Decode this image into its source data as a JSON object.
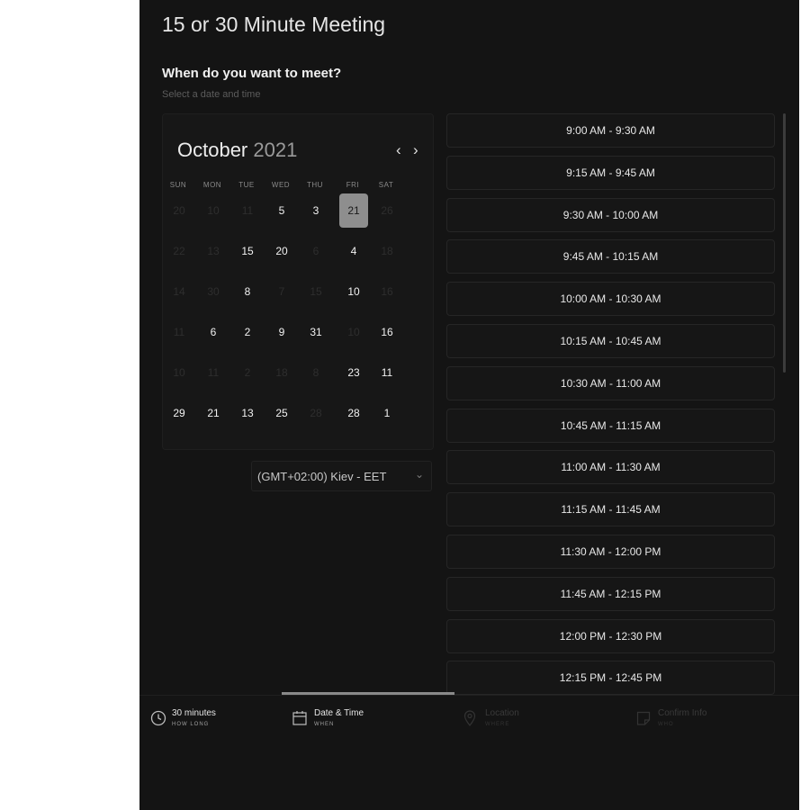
{
  "header": {
    "title": "15 or 30 Minute Meeting",
    "question": "When do you want to meet?",
    "subtitle": "Select a date and time"
  },
  "calendar": {
    "month": "October",
    "year": "2021",
    "prev_label": "‹",
    "next_label": "›",
    "weekdays": [
      "SUN",
      "MON",
      "TUE",
      "WED",
      "THU",
      "FRI",
      "SAT"
    ],
    "weeks": [
      [
        {
          "d": "20",
          "a": false
        },
        {
          "d": "10",
          "a": false
        },
        {
          "d": "11",
          "a": false
        },
        {
          "d": "5",
          "a": true
        },
        {
          "d": "3",
          "a": true
        },
        {
          "d": "21",
          "a": true,
          "sel": true
        },
        {
          "d": "26",
          "a": false
        }
      ],
      [
        {
          "d": "22",
          "a": false
        },
        {
          "d": "13",
          "a": false
        },
        {
          "d": "15",
          "a": true
        },
        {
          "d": "20",
          "a": true
        },
        {
          "d": "6",
          "a": false
        },
        {
          "d": "4",
          "a": true
        },
        {
          "d": "18",
          "a": false
        }
      ],
      [
        {
          "d": "14",
          "a": false
        },
        {
          "d": "30",
          "a": false
        },
        {
          "d": "8",
          "a": true
        },
        {
          "d": "7",
          "a": false
        },
        {
          "d": "15",
          "a": false
        },
        {
          "d": "10",
          "a": true
        },
        {
          "d": "16",
          "a": false
        }
      ],
      [
        {
          "d": "11",
          "a": false
        },
        {
          "d": "6",
          "a": true
        },
        {
          "d": "2",
          "a": true
        },
        {
          "d": "9",
          "a": true
        },
        {
          "d": "31",
          "a": true
        },
        {
          "d": "10",
          "a": false
        },
        {
          "d": "16",
          "a": true
        }
      ],
      [
        {
          "d": "10",
          "a": false
        },
        {
          "d": "11",
          "a": false
        },
        {
          "d": "2",
          "a": false
        },
        {
          "d": "18",
          "a": false
        },
        {
          "d": "8",
          "a": false
        },
        {
          "d": "23",
          "a": true
        },
        {
          "d": "11",
          "a": true
        }
      ],
      [
        {
          "d": "29",
          "a": true
        },
        {
          "d": "21",
          "a": true
        },
        {
          "d": "13",
          "a": true
        },
        {
          "d": "25",
          "a": true
        },
        {
          "d": "28",
          "a": false
        },
        {
          "d": "28",
          "a": true
        },
        {
          "d": "1",
          "a": true
        }
      ]
    ]
  },
  "timezone": {
    "value": "(GMT+02:00) Kiev - EET",
    "caret": "⌄"
  },
  "time_slots": [
    "9:00 AM - 9:30 AM",
    "9:15 AM - 9:45 AM",
    "9:30 AM - 10:00 AM",
    "9:45 AM - 10:15 AM",
    "10:00 AM - 10:30 AM",
    "10:15 AM - 10:45 AM",
    "10:30 AM - 11:00 AM",
    "10:45 AM - 11:15 AM",
    "11:00 AM - 11:30 AM",
    "11:15 AM - 11:45 AM",
    "11:30 AM - 12:00 PM",
    "11:45 AM - 12:15 PM",
    "12:00 PM - 12:30 PM",
    "12:15 PM - 12:45 PM"
  ],
  "tabs": [
    {
      "label": "30 minutes",
      "sub": "HOW LONG",
      "icon": "clock-icon",
      "active": true
    },
    {
      "label": "Date & Time",
      "sub": "WHEN",
      "icon": "calendar-icon",
      "active": true
    },
    {
      "label": "Location",
      "sub": "WHERE",
      "icon": "location-pin-icon",
      "active": false
    },
    {
      "label": "Confirm Info",
      "sub": "WHO",
      "icon": "note-icon",
      "active": false
    }
  ],
  "colors": {
    "background": "#141414",
    "selected_day": "#8e8e8e",
    "text": "#e8e8e8"
  }
}
